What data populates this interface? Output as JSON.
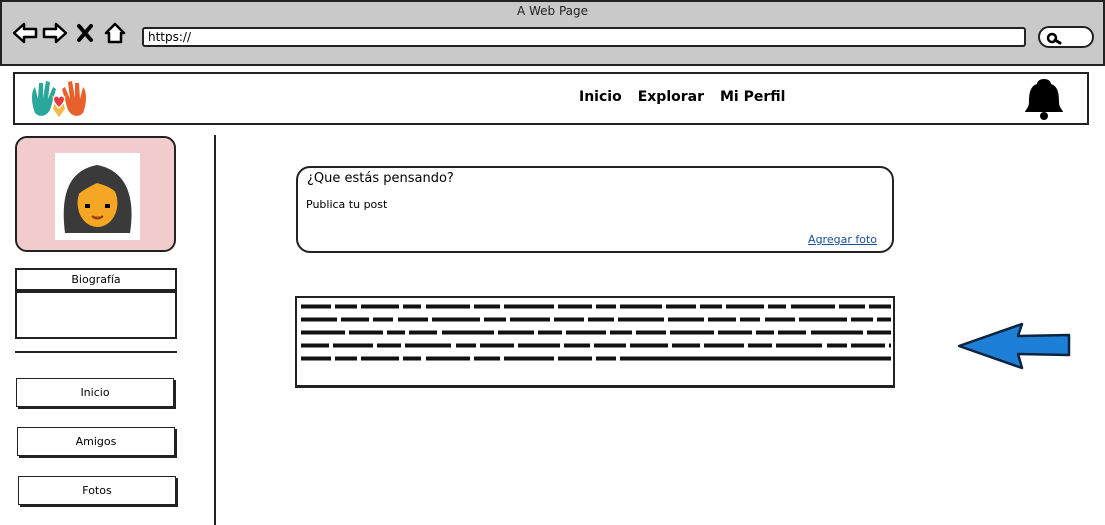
{
  "browser": {
    "window_title": "A Web Page",
    "url": "https://",
    "nav_icons": [
      "back-arrow-icon",
      "forward-arrow-icon",
      "close-x-icon",
      "home-icon"
    ],
    "search_icon": "search-icon"
  },
  "header": {
    "logo_icon": "hands-heart-logo",
    "nav": [
      "Inicio",
      "Explorar",
      "Mi Perfil"
    ],
    "notification_icon": "bell-icon"
  },
  "sidebar": {
    "avatar_icon": "user-avatar",
    "bio_title": "Biografía",
    "buttons": [
      "Inicio",
      "Amigos",
      "Fotos"
    ]
  },
  "composer": {
    "prompt": "¿Que estás pensando?",
    "placeholder": "Publica tu post",
    "add_photo_label": "Agregar foto"
  },
  "feed": {
    "post_content": "redacted scribble placeholder text",
    "pointer_icon": "blue-arrow-left-icon"
  },
  "colors": {
    "chrome_gray": "#c9c9c9",
    "profile_card_pink": "#f2cccc",
    "link_blue": "#1a4fa0",
    "arrow_blue": "#1e7fd6"
  }
}
